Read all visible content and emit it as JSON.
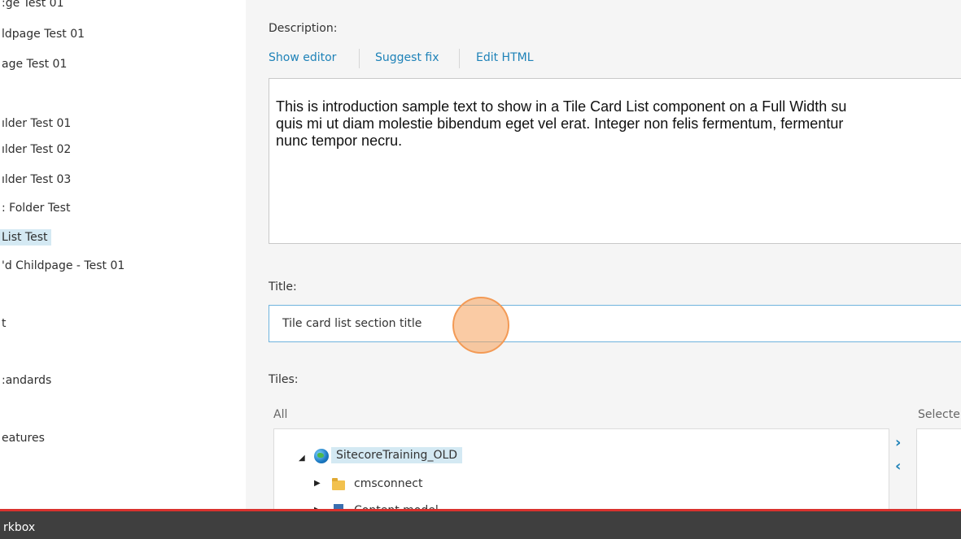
{
  "tree": {
    "items": [
      {
        "label": ":ge Test 01"
      },
      {
        "label": "ldpage Test 01"
      },
      {
        "label": "age Test 01"
      },
      {
        "label": "ılder Test 01"
      },
      {
        "label": "ılder Test 02"
      },
      {
        "label": "ılder Test 03"
      },
      {
        "label": ": Folder Test"
      },
      {
        "label": "List Test",
        "selected": true
      },
      {
        "label": "'d Childpage - Test 01"
      },
      {
        "label": "t"
      },
      {
        "label": ":andards"
      },
      {
        "label": "eatures"
      }
    ]
  },
  "description": {
    "label": "Description:",
    "links": [
      "Show editor",
      "Suggest fix",
      "Edit HTML"
    ],
    "text": "This is introduction sample text to show in a Tile Card List component on a Full Width su\nquis mi ut diam molestie bibendum eget vel erat. Integer non felis fermentum, fermentur\nnunc tempor necru."
  },
  "title_field": {
    "label": "Title:",
    "value": "Tile card list section title"
  },
  "tiles": {
    "label": "Tiles:",
    "all_label": "All",
    "selected_label": "Selecte",
    "tree": [
      {
        "label": "SitecoreTraining_OLD",
        "icon": "globe-icon",
        "toggle": "◢"
      },
      {
        "label": "cmsconnect",
        "icon": "folder-icon",
        "toggle": "▶"
      },
      {
        "label": "Content model",
        "icon": "template-icon",
        "toggle": "▶"
      }
    ],
    "add_arrow": "›",
    "remove_arrow": "‹"
  },
  "bottom_bar": {
    "label": "rkbox"
  },
  "colors": {
    "accent": "#1e82b8",
    "selection": "#d4e9f3",
    "bottom_bar": "#3f3f3f",
    "bottom_line": "#d9322e"
  }
}
